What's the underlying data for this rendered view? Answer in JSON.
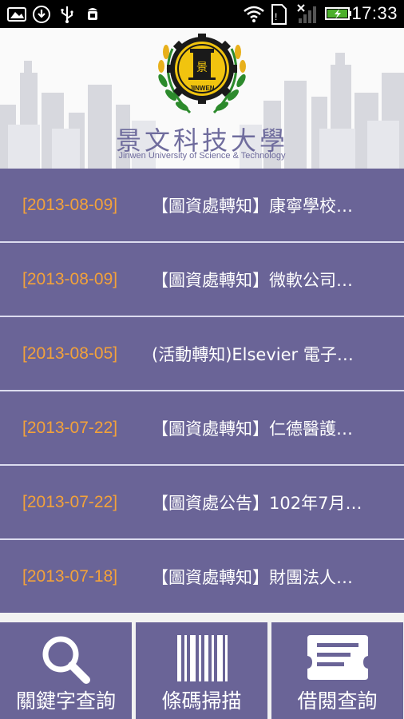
{
  "status_bar": {
    "time": "17:33",
    "left_icons": [
      "photo-icon",
      "download-icon",
      "usb-icon",
      "android-debug-icon"
    ],
    "right_icons": [
      "wifi-icon",
      "sim-icon",
      "signal-icon",
      "battery-charging-icon"
    ]
  },
  "header": {
    "title_cn": "景文科技大學",
    "title_en": "Jinwen University of Science & Technology",
    "logo_text": "JINWEN"
  },
  "news": [
    {
      "date": "[2013-08-09]",
      "title": "【圖資處轉知】康寧學校…"
    },
    {
      "date": "[2013-08-09]",
      "title": "【圖資處轉知】微軟公司…"
    },
    {
      "date": "[2013-08-05]",
      "title": "(活動轉知)Elsevier 電子…"
    },
    {
      "date": "[2013-07-22]",
      "title": "【圖資處轉知】仁德醫護…"
    },
    {
      "date": "[2013-07-22]",
      "title": "【圖資處公告】102年7月…"
    },
    {
      "date": "[2013-07-18]",
      "title": "【圖資處轉知】財團法人…"
    }
  ],
  "bottom_nav": [
    {
      "label": "關鍵字查詢",
      "icon": "search-icon"
    },
    {
      "label": "條碼掃描",
      "icon": "barcode-icon"
    },
    {
      "label": "借閱查詢",
      "icon": "ticket-icon"
    }
  ],
  "colors": {
    "list_bg": "#6a6497",
    "date": "#f3a23a",
    "divider": "#dcdcef"
  }
}
